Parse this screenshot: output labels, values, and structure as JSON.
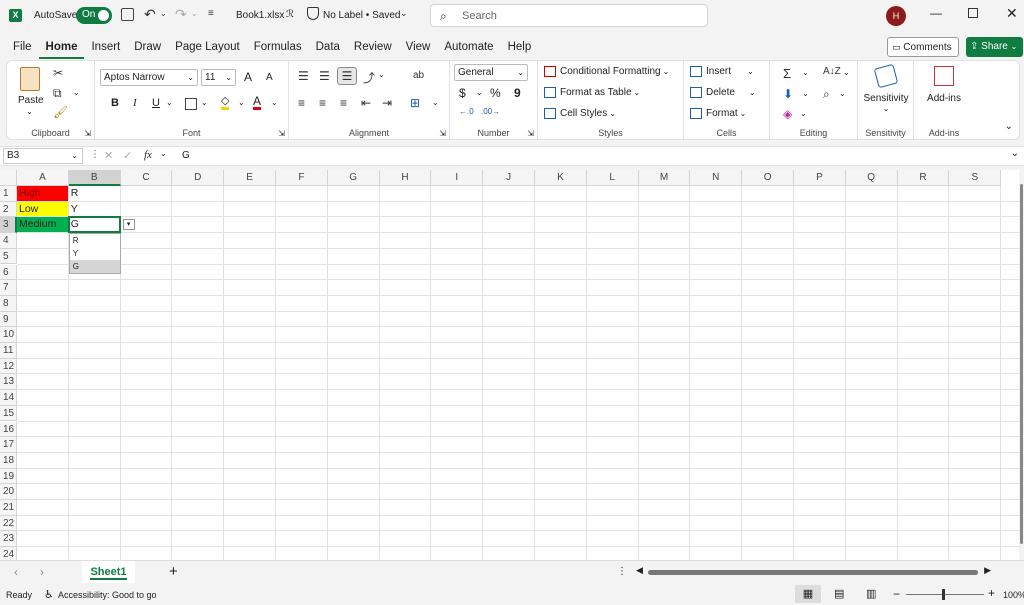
{
  "title_bar": {
    "autosave_label": "AutoSave",
    "autosave_state": "On",
    "filename": "Book1.xlsx",
    "label_status": "No Label • Saved",
    "search_placeholder": "Search",
    "user_initial": "H"
  },
  "tabs": [
    "File",
    "Home",
    "Insert",
    "Draw",
    "Page Layout",
    "Formulas",
    "Data",
    "Review",
    "View",
    "Automate",
    "Help"
  ],
  "active_tab": "Home",
  "ribbon_actions": {
    "comments": "Comments",
    "share": "Share"
  },
  "ribbon": {
    "clipboard": {
      "label": "Clipboard",
      "paste": "Paste"
    },
    "font": {
      "label": "Font",
      "name": "Aptos Narrow",
      "size": "11",
      "grow": "A",
      "shrink": "A",
      "bold": "B",
      "italic": "I",
      "underline": "U"
    },
    "alignment": {
      "label": "Alignment"
    },
    "number": {
      "label": "Number",
      "format": "General",
      "currency": "$",
      "percent": "%",
      "comma": "9"
    },
    "styles": {
      "label": "Styles",
      "conditional": "Conditional Formatting",
      "format_table": "Format as Table",
      "cell_styles": "Cell Styles"
    },
    "cells": {
      "label": "Cells",
      "insert": "Insert",
      "delete": "Delete",
      "format": "Format"
    },
    "editing": {
      "label": "Editing"
    },
    "sensitivity": {
      "label": "Sensitivity",
      "button": "Sensitivity"
    },
    "addins": {
      "label": "Add-ins",
      "button": "Add-ins"
    }
  },
  "formula_bar": {
    "name_box": "B3",
    "fx": "fx",
    "value": "G"
  },
  "columns": [
    "A",
    "B",
    "C",
    "D",
    "E",
    "F",
    "G",
    "H",
    "I",
    "J",
    "K",
    "L",
    "M",
    "N",
    "O",
    "P",
    "Q",
    "R",
    "S"
  ],
  "rows": [
    "1",
    "2",
    "3",
    "4",
    "5",
    "6",
    "7",
    "8",
    "9",
    "10",
    "11",
    "12",
    "13",
    "14",
    "15",
    "16",
    "17",
    "18",
    "19",
    "20",
    "21",
    "22",
    "23",
    "24"
  ],
  "cells": {
    "A1": "High",
    "A2": "Low",
    "A3": "Medium",
    "B1": "R",
    "B2": "Y",
    "B3": "G"
  },
  "cell_colors": {
    "A1": "#ff0000",
    "A2": "#ffff00",
    "A3": "#00b050"
  },
  "dropdown_options": [
    "R",
    "Y",
    "G"
  ],
  "dropdown_selected": "G",
  "sheet_tab": "Sheet1",
  "status": {
    "ready": "Ready",
    "accessibility": "Accessibility: Good to go",
    "zoom": "100%"
  }
}
